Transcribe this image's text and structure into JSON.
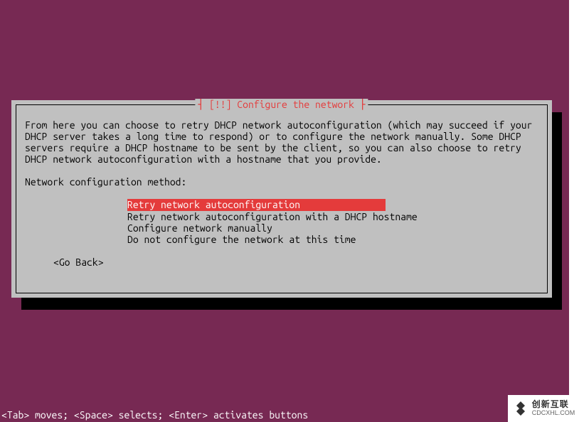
{
  "dialog": {
    "title_prefix": "┤ ",
    "title_marker": "[!!]",
    "title_text": " Configure the network",
    "title_suffix": " ├",
    "description": "From here you can choose to retry DHCP network autoconfiguration (which may succeed if your DHCP server takes a long time to respond) or to configure the network manually. Some DHCP servers require a DHCP hostname to be sent by the client, so you can also choose to retry DHCP network autoconfiguration with a hostname that you provide.",
    "prompt": "Network configuration method:",
    "options": [
      {
        "label": "Retry network autoconfiguration",
        "selected": true
      },
      {
        "label": "Retry network autoconfiguration with a DHCP hostname",
        "selected": false
      },
      {
        "label": "Configure network manually",
        "selected": false
      },
      {
        "label": "Do not configure the network at this time",
        "selected": false
      }
    ],
    "go_back": "<Go Back>"
  },
  "help_bar": "<Tab> moves; <Space> selects; <Enter> activates buttons",
  "watermark": {
    "brand": "创新互联",
    "sub": "CDCXHL.COM"
  }
}
